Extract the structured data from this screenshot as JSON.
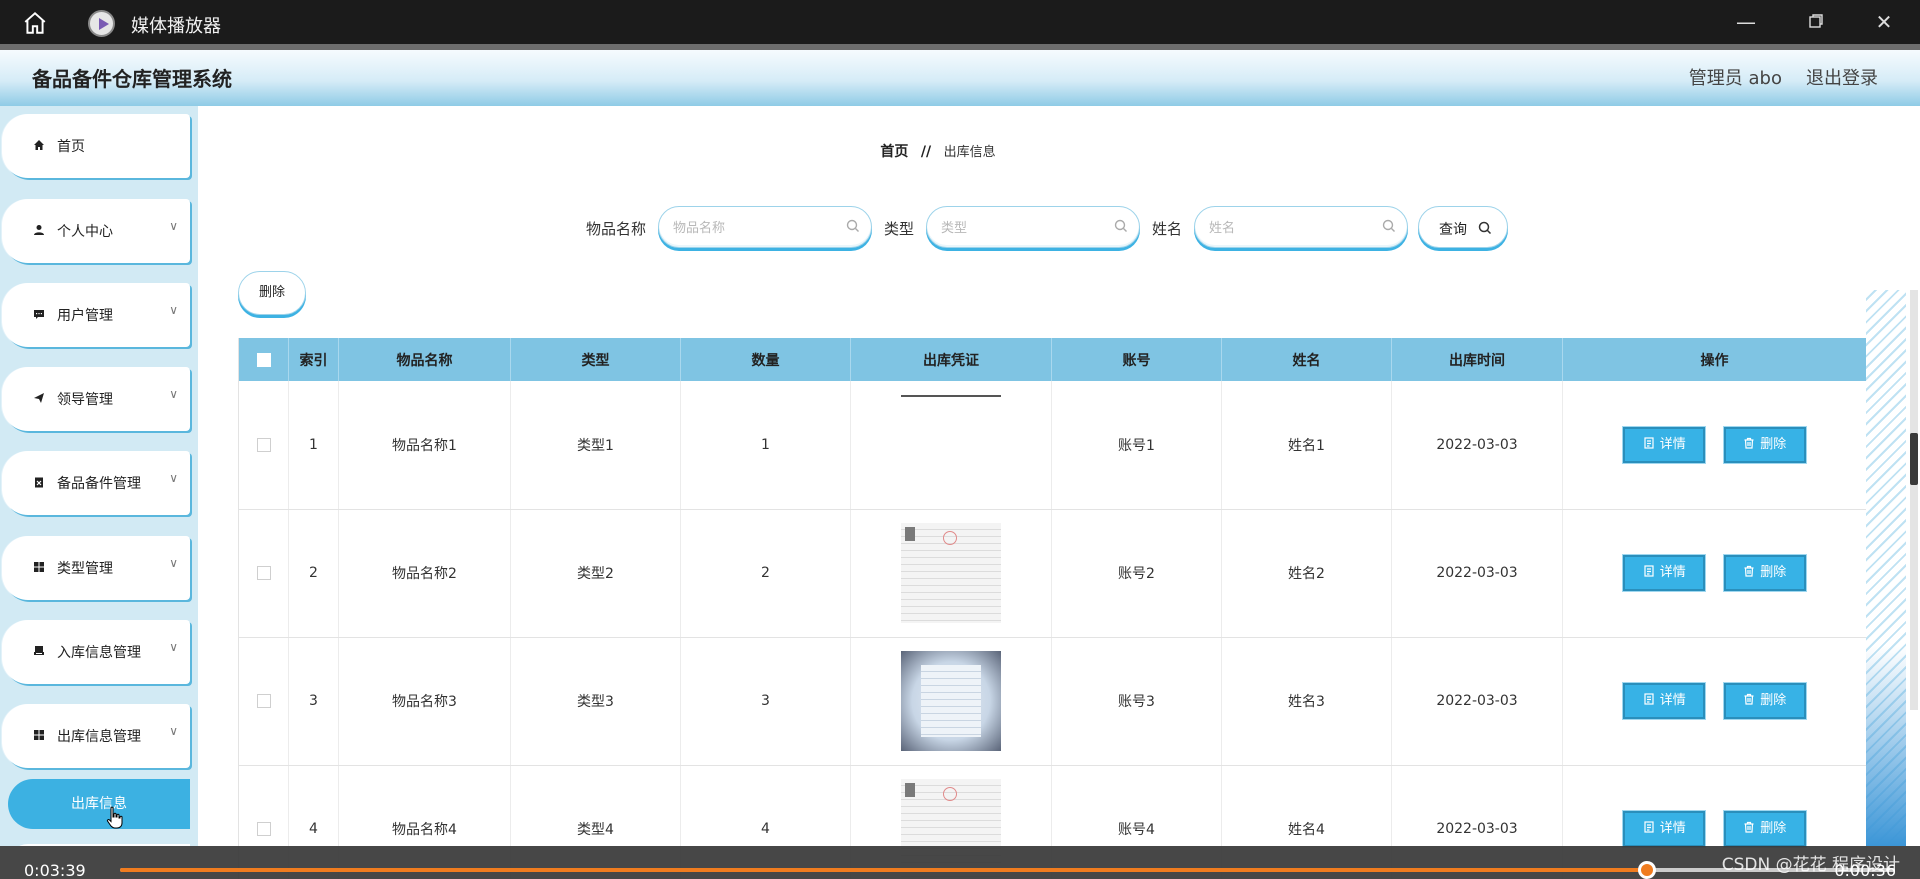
{
  "player": {
    "title": "媒体播放器",
    "time_elapsed": "0:03:39",
    "time_remaining": "0:00:36",
    "progress_percent": 86
  },
  "header": {
    "app_title": "备品备件仓库管理系统",
    "admin_text": "管理员 abo",
    "logout_label": "退出登录"
  },
  "sidebar": {
    "items": [
      {
        "label": "首页",
        "icon": "home-icon"
      },
      {
        "label": "个人中心",
        "icon": "user-icon"
      },
      {
        "label": "用户管理",
        "icon": "message-icon"
      },
      {
        "label": "领导管理",
        "icon": "send-icon"
      },
      {
        "label": "备品备件管理",
        "icon": "clipboard-icon"
      },
      {
        "label": "类型管理",
        "icon": "grid-icon"
      },
      {
        "label": "入库信息管理",
        "icon": "printer-icon"
      },
      {
        "label": "出库信息管理",
        "icon": "grid-icon"
      }
    ],
    "active_sub": "出库信息"
  },
  "breadcrumb": {
    "home": "首页",
    "separator": "//",
    "current": "出库信息"
  },
  "filters": {
    "item_name_label": "物品名称",
    "item_name_placeholder": "物品名称",
    "type_label": "类型",
    "type_placeholder": "类型",
    "name_label": "姓名",
    "name_placeholder": "姓名",
    "query_label": "查询"
  },
  "toolbar": {
    "delete_label": "删除"
  },
  "table": {
    "headers": [
      "索引",
      "物品名称",
      "类型",
      "数量",
      "出库凭证",
      "账号",
      "姓名",
      "出库时间",
      "操作"
    ],
    "detail_label": "详情",
    "delete_label": "删除",
    "rows": [
      {
        "index": "1",
        "item_name": "物品名称1",
        "type": "类型1",
        "quantity": "1",
        "voucher": "blank",
        "account": "账号1",
        "name": "姓名1",
        "time": "2022-03-03"
      },
      {
        "index": "2",
        "item_name": "物品名称2",
        "type": "类型2",
        "quantity": "2",
        "voucher": "doc",
        "account": "账号2",
        "name": "姓名2",
        "time": "2022-03-03"
      },
      {
        "index": "3",
        "item_name": "物品名称3",
        "type": "类型3",
        "quantity": "3",
        "voucher": "photo",
        "account": "账号3",
        "name": "姓名3",
        "time": "2022-03-03"
      },
      {
        "index": "4",
        "item_name": "物品名称4",
        "type": "类型4",
        "quantity": "4",
        "voucher": "doc",
        "account": "账号4",
        "name": "姓名4",
        "time": "2022-03-03"
      }
    ]
  },
  "watermark": "CSDN @花花 程序设计",
  "colors": {
    "accent": "#37b2e6",
    "table_header": "#7fc4e3",
    "progress": "#f07c1f"
  }
}
